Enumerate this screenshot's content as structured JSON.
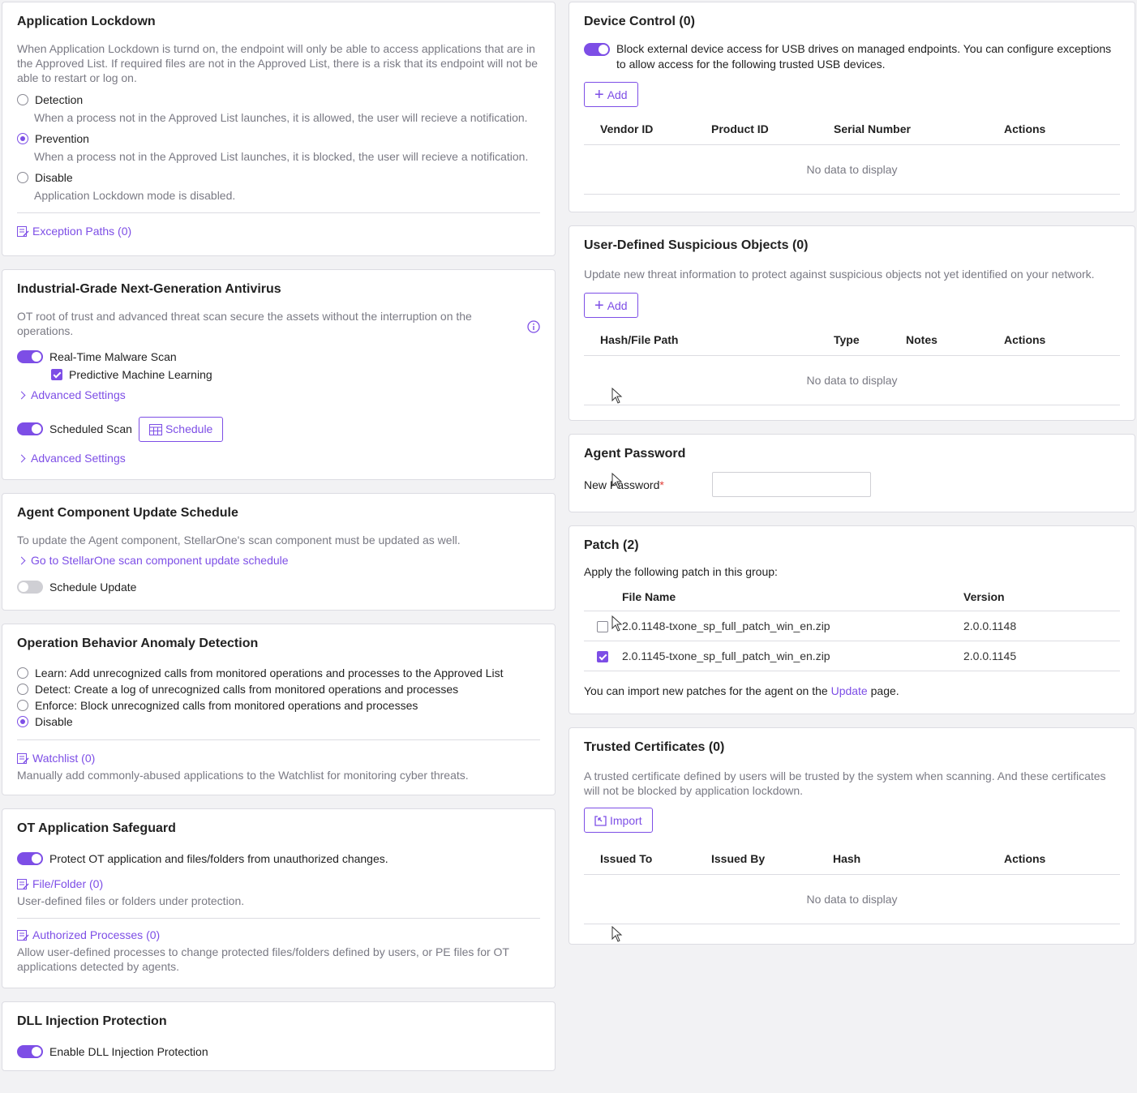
{
  "colors": {
    "accent": "#7d4ee6",
    "muted_text": "#7a7a84",
    "border": "#dcdce2"
  },
  "app_lockdown": {
    "title": "Application Lockdown",
    "description": "When Application Lockdown is turnd on, the endpoint will only be able to access applications that are in the Approved List. If required files are not in the Approved List, there is a risk that its endpoint will not be able to restart or log on.",
    "options": [
      {
        "label": "Detection",
        "desc": "When a process not in the Approved List launches, it is allowed, the user will recieve a notification.",
        "selected": false
      },
      {
        "label": "Prevention",
        "desc": "When a process not in the Approved List launches, it is blocked, the user will recieve a notification.",
        "selected": true
      },
      {
        "label": "Disable",
        "desc": "Application Lockdown mode is disabled.",
        "selected": false
      }
    ],
    "exception_link": "Exception Paths (0)"
  },
  "antivirus": {
    "title": "Industrial-Grade Next-Generation Antivirus",
    "description": "OT root of trust and advanced threat scan secure the assets without the interruption on the operations.",
    "realtime_label": "Real-Time Malware Scan",
    "realtime_on": true,
    "pml_label": "Predictive Machine Learning",
    "pml_checked": true,
    "advanced_label_1": "Advanced Settings",
    "scheduled_label": "Scheduled Scan",
    "scheduled_on": true,
    "schedule_button": "Schedule",
    "advanced_label_2": "Advanced Settings"
  },
  "agent_update": {
    "title": "Agent Component Update Schedule",
    "description": "To update the Agent component, StellarOne's scan component must be updated as well.",
    "link": "Go to StellarOne scan component update schedule",
    "toggle_label": "Schedule Update",
    "toggle_on": false
  },
  "anomaly": {
    "title": "Operation Behavior Anomaly Detection",
    "options": [
      {
        "label": "Learn: Add unrecognized calls from monitored operations and processes to the Approved List",
        "selected": false
      },
      {
        "label": "Detect: Create a log of unrecognized calls from monitored operations and processes",
        "selected": false
      },
      {
        "label": "Enforce: Block unrecognized calls from monitored operations and processes",
        "selected": false
      },
      {
        "label": "Disable",
        "selected": true
      }
    ],
    "watchlist_link": "Watchlist (0)",
    "watchlist_desc": "Manually add commonly-abused applications to the Watchlist for monitoring cyber threats."
  },
  "safeguard": {
    "title": "OT Application Safeguard",
    "toggle_label": "Protect OT application and files/folders from unauthorized changes.",
    "toggle_on": true,
    "file_link": "File/Folder (0)",
    "file_desc": "User-defined files or folders under protection.",
    "auth_link": "Authorized Processes (0)",
    "auth_desc": "Allow user-defined processes to change protected files/folders defined by users, or PE files for OT applications detected by agents."
  },
  "dll": {
    "title": "DLL Injection Protection",
    "toggle_label": "Enable DLL Injection Protection",
    "toggle_on": true
  },
  "device_control": {
    "title": "Device Control (0)",
    "toggle_text": "Block external device access for USB drives on managed endpoints. You can configure exceptions to allow access for the following trusted USB devices.",
    "toggle_on": true,
    "add_button": "Add",
    "columns": [
      "Vendor ID",
      "Product ID",
      "Serial Number",
      "Actions"
    ],
    "empty": "No data to display"
  },
  "suspicious": {
    "title": "User-Defined Suspicious Objects (0)",
    "description": "Update new threat information to protect against suspicious objects not yet identified on your network.",
    "add_button": "Add",
    "columns": [
      "Hash/File Path",
      "Type",
      "Notes",
      "Actions"
    ],
    "empty": "No data to display"
  },
  "agent_password": {
    "title": "Agent Password",
    "label": "New Password",
    "required_mark": "*",
    "value": ""
  },
  "patch": {
    "title": "Patch (2)",
    "description": "Apply the following patch in this group:",
    "columns": [
      "File Name",
      "Version"
    ],
    "rows": [
      {
        "name": "2.0.1148-txone_sp_full_patch_win_en.zip",
        "version": "2.0.0.1148",
        "checked": false
      },
      {
        "name": "2.0.1145-txone_sp_full_patch_win_en.zip",
        "version": "2.0.0.1145",
        "checked": true
      }
    ],
    "footer_before": "You can import new patches for the agent on the",
    "footer_link": "Update",
    "footer_after": "page."
  },
  "certs": {
    "title": "Trusted Certificates (0)",
    "description": "A trusted certificate defined by users will be trusted by the system when scanning. And these certificates will not be blocked by application lockdown.",
    "import_button": "Import",
    "columns": [
      "Issued To",
      "Issued By",
      "Hash",
      "Actions"
    ],
    "empty": "No data to display"
  }
}
